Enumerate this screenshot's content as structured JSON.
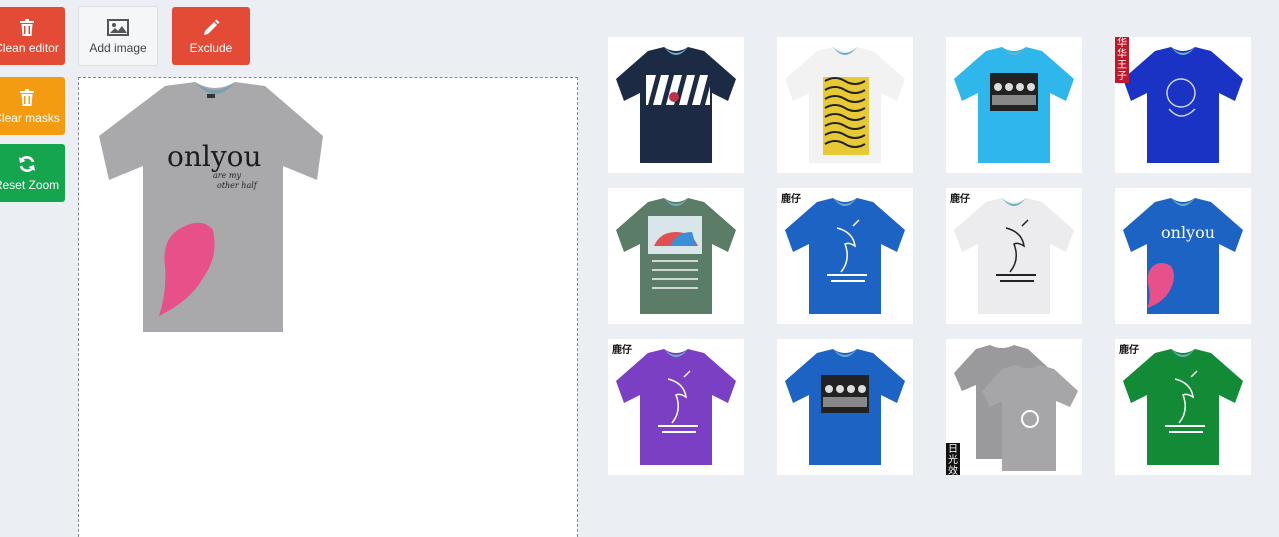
{
  "toolbar": {
    "clean_editor": "Clean editor",
    "add_image": "Add image",
    "exclude": "Exclude",
    "clear_masks": "Clear masks",
    "reset_zoom": "Reset Zoom"
  },
  "editor_shirt": {
    "color": "#a9a9ab",
    "print_main": "onlyou",
    "print_sub1": "are my",
    "print_sub2": "other half",
    "heart_color": "#e8508a"
  },
  "gallery": [
    {
      "color": "#1d2a44",
      "print": "zebra",
      "brand": ""
    },
    {
      "color": "#f2f2f2",
      "print": "pattern",
      "brand": ""
    },
    {
      "color": "#2fb6ea",
      "print": "photo",
      "brand": ""
    },
    {
      "color": "#1a33c4",
      "print": "doodle",
      "brand": "华华王子"
    },
    {
      "color": "#5b7c66",
      "print": "car",
      "brand": ""
    },
    {
      "color": "#1c63c4",
      "print": "deer",
      "brand": "鹿仔"
    },
    {
      "color": "#ececee",
      "print": "deer-dark",
      "brand": "鹿仔"
    },
    {
      "color": "#1c63c4",
      "print": "onlyou",
      "brand": ""
    },
    {
      "color": "#7b3fc4",
      "print": "deer",
      "brand": "鹿仔"
    },
    {
      "color": "#1c63c4",
      "print": "photo",
      "brand": ""
    },
    {
      "color": "#a6a6a8",
      "print": "double",
      "brand": "日光效果"
    },
    {
      "color": "#138a36",
      "print": "deer",
      "brand": "鹿仔"
    }
  ]
}
